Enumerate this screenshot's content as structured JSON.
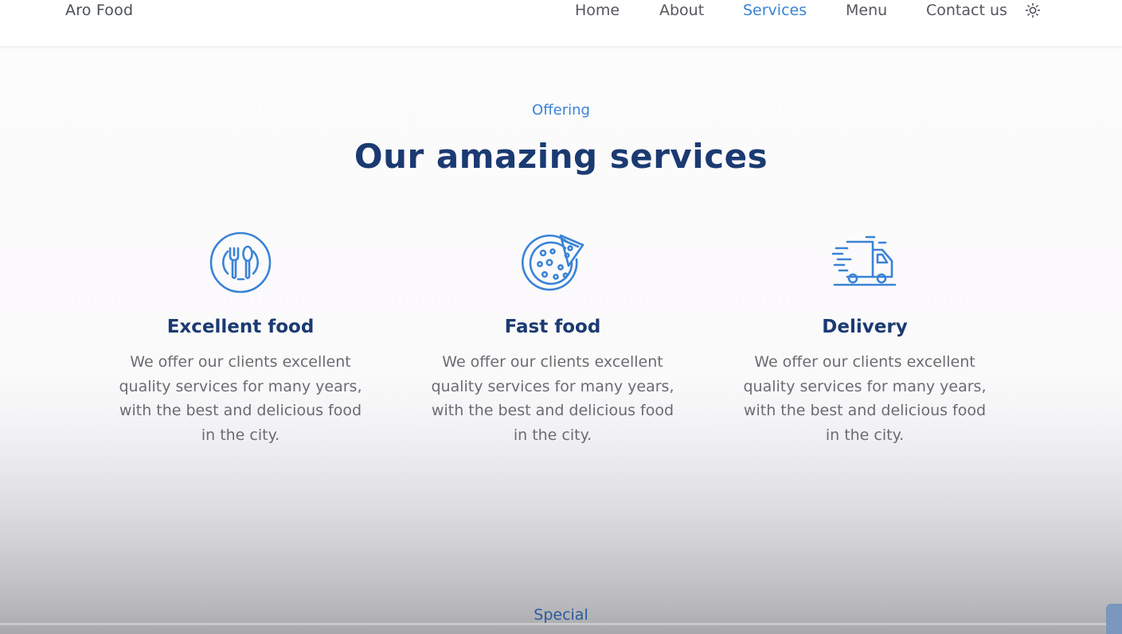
{
  "header": {
    "logo": "Aro Food",
    "nav": [
      {
        "label": "Home",
        "active": false
      },
      {
        "label": "About",
        "active": false
      },
      {
        "label": "Services",
        "active": true
      },
      {
        "label": "Menu",
        "active": false
      },
      {
        "label": "Contact us",
        "active": false
      }
    ],
    "theme_icon": "sun-icon"
  },
  "services": {
    "subtitle": "Offering",
    "title": "Our amazing services",
    "cards": [
      {
        "icon": "cutlery-plate-icon",
        "title": "Excellent food",
        "text": "We offer our clients excellent quality services for many years, with the best and delicious food in the city."
      },
      {
        "icon": "pizza-icon",
        "title": "Fast food",
        "text": "We offer our clients excellent quality services for many years, with the best and delicious food in the city."
      },
      {
        "icon": "delivery-truck-icon",
        "title": "Delivery",
        "text": "We offer our clients excellent quality services for many years, with the best and delicious food in the city."
      }
    ]
  },
  "next_section": {
    "subtitle": "Special"
  },
  "colors": {
    "accent": "#3a83d6",
    "title": "#1b3a72",
    "text": "#6a6c72"
  }
}
